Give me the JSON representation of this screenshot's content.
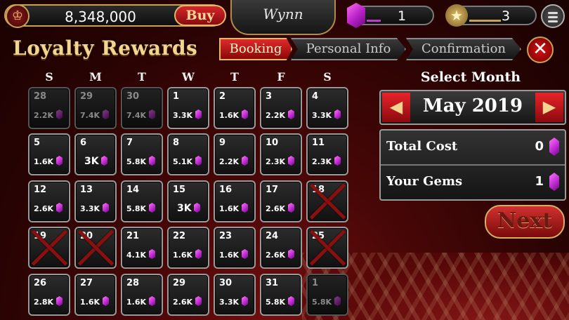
{
  "topbar": {
    "coins": "8,348,000",
    "buy_label": "Buy",
    "logo_text": "Wynn",
    "gems": "1",
    "level": "3",
    "gem_progress": 0.2,
    "level_progress": 0.5
  },
  "title": "Loyalty Rewards",
  "tabs": [
    {
      "label": "Booking",
      "active": true
    },
    {
      "label": "Personal Info",
      "active": false
    },
    {
      "label": "Confirmation",
      "active": false
    }
  ],
  "weekdays": [
    "S",
    "M",
    "T",
    "W",
    "T",
    "F",
    "S"
  ],
  "calendar": [
    [
      {
        "day": "28",
        "price": "2.2K",
        "state": "dim"
      },
      {
        "day": "29",
        "price": "7.4K",
        "state": "dim"
      },
      {
        "day": "30",
        "price": "7.4K",
        "state": "dim"
      },
      {
        "day": "1",
        "price": "3.3K",
        "state": "open"
      },
      {
        "day": "2",
        "price": "1.6K",
        "state": "open"
      },
      {
        "day": "3",
        "price": "2.2K",
        "state": "open"
      },
      {
        "day": "4",
        "price": "3.3K",
        "state": "open"
      }
    ],
    [
      {
        "day": "5",
        "price": "1.6K",
        "state": "open"
      },
      {
        "day": "6",
        "price": "3K",
        "state": "open"
      },
      {
        "day": "7",
        "price": "5.8K",
        "state": "open"
      },
      {
        "day": "8",
        "price": "5.1K",
        "state": "open"
      },
      {
        "day": "9",
        "price": "2.2K",
        "state": "open"
      },
      {
        "day": "10",
        "price": "2.3K",
        "state": "open"
      },
      {
        "day": "11",
        "price": "2.3K",
        "state": "open"
      }
    ],
    [
      {
        "day": "12",
        "price": "2.6K",
        "state": "open"
      },
      {
        "day": "13",
        "price": "3.3K",
        "state": "open"
      },
      {
        "day": "14",
        "price": "5.8K",
        "state": "open"
      },
      {
        "day": "15",
        "price": "3K",
        "state": "open"
      },
      {
        "day": "16",
        "price": "1.6K",
        "state": "open"
      },
      {
        "day": "17",
        "price": "2.6K",
        "state": "open"
      },
      {
        "day": "18",
        "price": "",
        "state": "blocked"
      }
    ],
    [
      {
        "day": "19",
        "price": "",
        "state": "blocked"
      },
      {
        "day": "20",
        "price": "",
        "state": "blocked"
      },
      {
        "day": "21",
        "price": "4.1K",
        "state": "open"
      },
      {
        "day": "22",
        "price": "1.6K",
        "state": "open"
      },
      {
        "day": "23",
        "price": "1.6K",
        "state": "open"
      },
      {
        "day": "24",
        "price": "2.6K",
        "state": "open"
      },
      {
        "day": "25",
        "price": "",
        "state": "blocked"
      }
    ],
    [
      {
        "day": "26",
        "price": "2.8K",
        "state": "open"
      },
      {
        "day": "27",
        "price": "1.6K",
        "state": "open"
      },
      {
        "day": "28",
        "price": "1.6K",
        "state": "open"
      },
      {
        "day": "29",
        "price": "2.6K",
        "state": "open"
      },
      {
        "day": "30",
        "price": "3.3K",
        "state": "open"
      },
      {
        "day": "31",
        "price": "5.8K",
        "state": "open"
      },
      {
        "day": "1",
        "price": "5.8K",
        "state": "dim"
      }
    ]
  ],
  "panel": {
    "select_month_label": "Select Month",
    "month": "May 2019",
    "prev_icon": "◀",
    "next_icon": "▶",
    "total_cost_label": "Total Cost",
    "total_cost_value": "0",
    "your_gems_label": "Your Gems",
    "your_gems_value": "1",
    "next_label": "Next"
  },
  "colors": {
    "accent_gold": "#f3d58f",
    "button_red": "#d23030",
    "gem_pink": "#c02bd4"
  }
}
